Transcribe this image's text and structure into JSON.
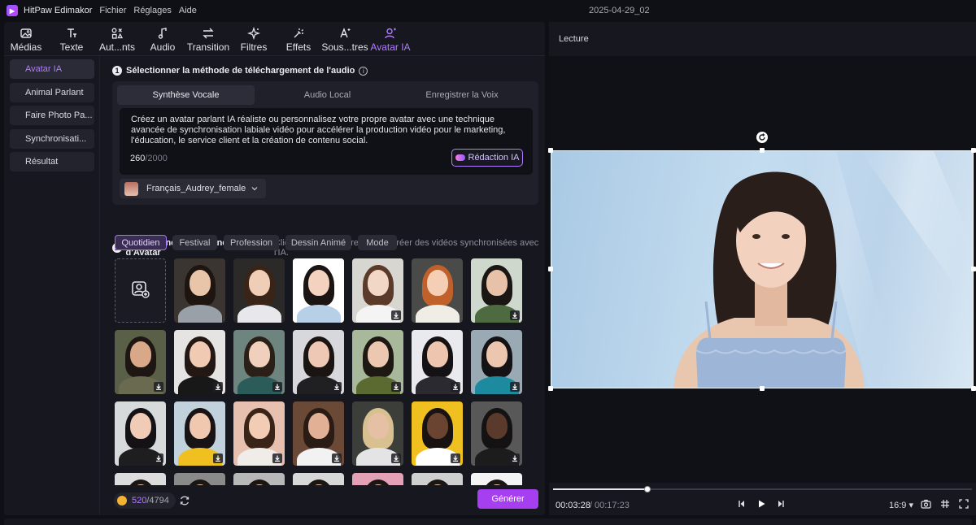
{
  "menubar": {
    "app_name": "HitPaw Edimakor",
    "items": [
      "Fichier",
      "Réglages",
      "Aide"
    ],
    "project_name": "2025-04-29_02"
  },
  "toolbar": {
    "tools": [
      {
        "label": "Médias",
        "icon": "image-icon"
      },
      {
        "label": "Texte",
        "icon": "text-icon"
      },
      {
        "label": "Aut...nts",
        "icon": "elements-icon"
      },
      {
        "label": "Audio",
        "icon": "music-note-icon"
      },
      {
        "label": "Transition",
        "icon": "transition-icon"
      },
      {
        "label": "Filtres",
        "icon": "sparkle-icon"
      },
      {
        "label": "Effets",
        "icon": "effects-icon"
      },
      {
        "label": "Sous...tres",
        "icon": "subtitle-icon"
      },
      {
        "label": "Avatar IA",
        "icon": "avatar-ia-icon",
        "active": true
      }
    ],
    "accent": "#b27cff"
  },
  "sidebar": {
    "items": [
      {
        "label": "Avatar IA",
        "active": true
      },
      {
        "label": "Animal Parlant"
      },
      {
        "label": "Faire Photo Pa..."
      },
      {
        "label": "Synchronisati..."
      },
      {
        "label": "Résultat"
      }
    ]
  },
  "step1": {
    "number": "1",
    "title": "Sélectionner la méthode de téléchargement de l'audio",
    "tabs": [
      {
        "label": "Synthèse Vocale",
        "active": true
      },
      {
        "label": "Audio Local"
      },
      {
        "label": "Enregistrer la Voix"
      }
    ],
    "text": "Créez un avatar parlant IA réaliste ou personnalisez votre propre avatar avec une technique avancée de synchronisation labiale vidéo pour accélérer la production vidéo pour le marketing, l'éducation, le service client et la création de contenu social.",
    "char_current": "260",
    "char_max": "/2000",
    "redaction_label": "Rédaction IA",
    "voice_name": "Français_Audrey_female"
  },
  "step2": {
    "number": "2",
    "title": "Sélectionnez l'apparence d'Avatar",
    "hint": "Cliquez sur « Générer » pour créer des vidéos synchronisées avec l'IA.",
    "categories": [
      {
        "label": "Quotidien",
        "active": true
      },
      {
        "label": "Festival"
      },
      {
        "label": "Profession"
      },
      {
        "label": "Dessin Animé"
      },
      {
        "label": "Mode"
      }
    ],
    "avatars": [
      {
        "bg": "#3a3530",
        "skin": "#e8c4a8",
        "hair": "#1e1410",
        "body": "#9aa0a8"
      },
      {
        "bg": "#2c2a28",
        "skin": "#f0cdb6",
        "hair": "#3a2418",
        "body": "#e8e8ec"
      },
      {
        "bg": "#ffffff",
        "skin": "#f4d2c0",
        "hair": "#1a1412",
        "body": "#b8cfe8",
        "selected": true
      },
      {
        "bg": "#d8d6d0",
        "skin": "#f2d6c6",
        "hair": "#5a3a28",
        "body": "#f4f4f4",
        "download": true
      },
      {
        "bg": "#4a4a48",
        "skin": "#f4cfb6",
        "hair": "#c0602a",
        "body": "#f0ece6"
      },
      {
        "bg": "#cfd8cc",
        "skin": "#e8c2a8",
        "hair": "#1a1614",
        "body": "#4e6a40",
        "download": true
      },
      {
        "bg": "#5a6048",
        "skin": "#d8a888",
        "hair": "#1e1612",
        "body": "#6a6a50",
        "download": true
      },
      {
        "bg": "#e6e4e2",
        "skin": "#f0cab2",
        "hair": "#241814",
        "body": "#181818",
        "download": true
      },
      {
        "bg": "#6e847e",
        "skin": "#f0cfbc",
        "hair": "#2a2018",
        "body": "#2c5c5a",
        "download": true
      },
      {
        "bg": "#d8d8dc",
        "skin": "#eec8b4",
        "hair": "#1a1412",
        "body": "#202022",
        "download": true
      },
      {
        "bg": "#a8b89a",
        "skin": "#ecc8b0",
        "hair": "#1e1812",
        "body": "#5a6a30",
        "download": true
      },
      {
        "bg": "#eaeaee",
        "skin": "#eec6b0",
        "hair": "#141214",
        "body": "#2a2a30",
        "download": true
      },
      {
        "bg": "#9aaab4",
        "skin": "#ecc6ae",
        "hair": "#141214",
        "body": "#1e8aa0",
        "download": true
      },
      {
        "bg": "#d6dada",
        "skin": "#f0ccb6",
        "hair": "#141214",
        "body": "#1e1e20",
        "download": true
      },
      {
        "bg": "#c2d2dc",
        "skin": "#f0c8b0",
        "hair": "#181416",
        "body": "#f0c020",
        "download": true
      },
      {
        "bg": "#e8c0b0",
        "skin": "#f2ccb4",
        "hair": "#3a2418",
        "body": "#f0ece8",
        "download": true
      },
      {
        "bg": "#6a4a36",
        "skin": "#e2b094",
        "hair": "#2a1c14",
        "body": "#f2f2f2",
        "download": true
      },
      {
        "bg": "#3c3e3a",
        "skin": "#e6c0a4",
        "hair": "#d8c090",
        "body": "#e4e4e6",
        "download": true
      },
      {
        "bg": "#f0c020",
        "skin": "#6a4430",
        "hair": "#181212",
        "body": "#ffffff",
        "download": true
      },
      {
        "bg": "#585858",
        "skin": "#5a3a2a",
        "hair": "#141212",
        "body": "#1c1c1c",
        "download": true
      },
      {
        "bg": "#dcdcdc",
        "skin": "#e8c4ae",
        "hair": "#1a1614"
      },
      {
        "bg": "#8a8a8a",
        "skin": "#e6c2a8",
        "hair": "#1a1614"
      },
      {
        "bg": "#b8b8b8",
        "skin": "#eac6ae",
        "hair": "#1a1614"
      },
      {
        "bg": "#d8d8d8",
        "skin": "#e8c2aa",
        "hair": "#1a1614"
      },
      {
        "bg": "#e4a0b4",
        "skin": "#eac4ac",
        "hair": "#1a1614"
      },
      {
        "bg": "#cfcfcf",
        "skin": "#e6c0a6",
        "hair": "#1a1614"
      },
      {
        "bg": "#f4f4f4",
        "skin": "#eac6ae",
        "hair": "#1a1614"
      }
    ]
  },
  "footer": {
    "credit_current": "520",
    "credit_max": "/4794",
    "generate_label": "Générer"
  },
  "preview": {
    "label": "Lecture",
    "time_current": "00:03:28",
    "time_separator": "/",
    "time_total": "00:17:23",
    "progress": 0.225,
    "aspect_ratio": "16:9"
  }
}
